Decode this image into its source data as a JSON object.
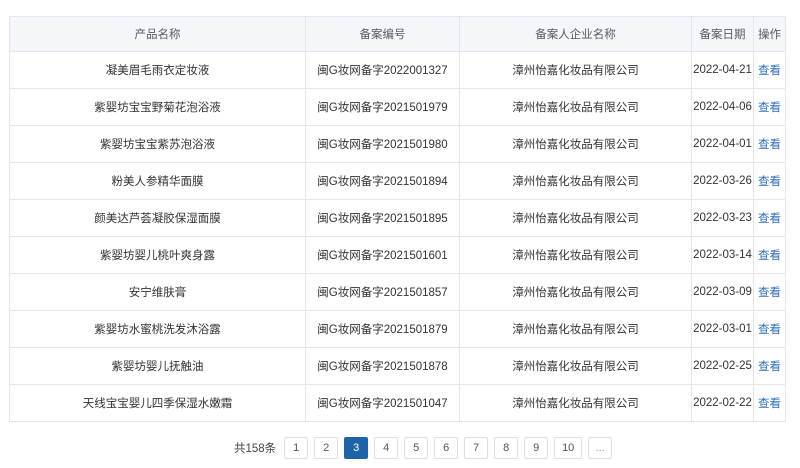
{
  "table": {
    "headers": [
      "产品名称",
      "备案编号",
      "备案人企业名称",
      "备案日期",
      "操作"
    ],
    "rows": [
      {
        "name": "凝美眉毛雨衣定妆液",
        "code": "闽G妆网备字2022001327",
        "company": "漳州怡嘉化妆品有限公司",
        "date": "2022-04-21",
        "action": "查看"
      },
      {
        "name": "紫婴坊宝宝野菊花泡浴液",
        "code": "闽G妆网备字2021501979",
        "company": "漳州怡嘉化妆品有限公司",
        "date": "2022-04-06",
        "action": "查看"
      },
      {
        "name": "紫婴坊宝宝紫苏泡浴液",
        "code": "闽G妆网备字2021501980",
        "company": "漳州怡嘉化妆品有限公司",
        "date": "2022-04-01",
        "action": "查看"
      },
      {
        "name": "粉美人参精华面膜",
        "code": "闽G妆网备字2021501894",
        "company": "漳州怡嘉化妆品有限公司",
        "date": "2022-03-26",
        "action": "查看"
      },
      {
        "name": "颜美达芦荟凝胶保湿面膜",
        "code": "闽G妆网备字2021501895",
        "company": "漳州怡嘉化妆品有限公司",
        "date": "2022-03-23",
        "action": "查看"
      },
      {
        "name": "紫婴坊婴儿桃叶爽身露",
        "code": "闽G妆网备字2021501601",
        "company": "漳州怡嘉化妆品有限公司",
        "date": "2022-03-14",
        "action": "查看"
      },
      {
        "name": "安宁维肤膏",
        "code": "闽G妆网备字2021501857",
        "company": "漳州怡嘉化妆品有限公司",
        "date": "2022-03-09",
        "action": "查看"
      },
      {
        "name": "紫婴坊水蜜桃洗发沐浴露",
        "code": "闽G妆网备字2021501879",
        "company": "漳州怡嘉化妆品有限公司",
        "date": "2022-03-01",
        "action": "查看"
      },
      {
        "name": "紫婴坊婴儿抚触油",
        "code": "闽G妆网备字2021501878",
        "company": "漳州怡嘉化妆品有限公司",
        "date": "2022-02-25",
        "action": "查看"
      },
      {
        "name": "天线宝宝婴儿四季保湿水嫩霜",
        "code": "闽G妆网备字2021501047",
        "company": "漳州怡嘉化妆品有限公司",
        "date": "2022-02-22",
        "action": "查看"
      }
    ]
  },
  "pagination": {
    "total_label": "共158条",
    "pages": [
      "1",
      "2",
      "3",
      "4",
      "5",
      "6",
      "7",
      "8",
      "9",
      "10",
      "..."
    ],
    "current": "3"
  },
  "colors": {
    "header_bg": "#f4f6f9",
    "border": "#e3e6ea",
    "link": "#2f6fbf",
    "active_page": "#1e63a8"
  }
}
